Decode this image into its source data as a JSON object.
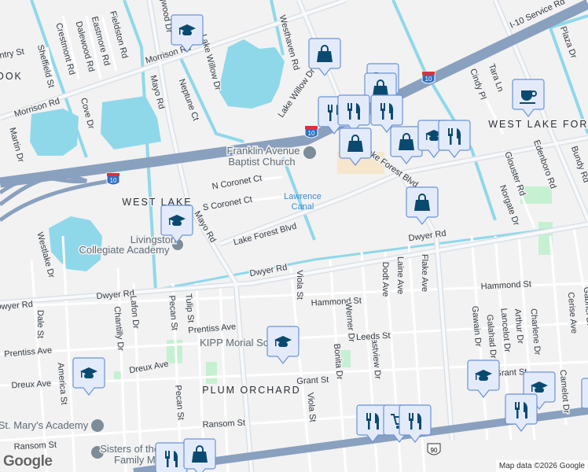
{
  "map": {
    "areas": [
      "WEST LAKE",
      "WEST LAKE FOREST",
      "PLUM ORCHARD",
      "OOK"
    ],
    "streets": [
      "Morrison Rd",
      "Morrison Rd",
      "Mayo Rd",
      "Mayo Rd",
      "Neptune Ct",
      "Lake Willow Dr",
      "Westhaven Rd",
      "Lake Willow Dr",
      "Crestmont Rd",
      "Dalewood Rd",
      "Eastmore Rd",
      "Fieldston Rd",
      "Sheffield St",
      "Cove Dr",
      "Martin Dr",
      "Dogwood Dr",
      "N Coronet Ct",
      "S Coronet Ct",
      "Lake Forest Blvd",
      "Dwyer Rd",
      "Dwyer Rd",
      "Dwyer Rd",
      "Dwyer Rd",
      "Westlake Dr",
      "I-10 Service Rd",
      "Cindy Pl",
      "Tara Ln",
      "Plaza Dr",
      "Edenboro Rd",
      "Glouster Rd",
      "Norgate Dr",
      "Bundy Rd",
      "Lake Forest Blvd",
      "Viola St",
      "Dodt Ave",
      "Laine Ave",
      "Flake Ave",
      "Hammond St",
      "Hammond St",
      "Werner Dr",
      "Eastview Dr",
      "Bonita Dr",
      "Leeds St",
      "Prentiss Ave",
      "Prentiss Ave",
      "Dreux Ave",
      "Dreux Ave",
      "Grant St",
      "Grant St",
      "Ransom St",
      "Ransom St",
      "Dale St",
      "America St",
      "Chantilly Dr",
      "Lafon Dr",
      "Pecan St",
      "Tulip St",
      "Pecan St",
      "Viola St",
      "Gawain Dr",
      "Galahad Dr",
      "Lancelot Dr",
      "Arthur Dr",
      "Charlene Dr",
      "Cerise Ave",
      "Gabriel Dr",
      "Camelot Dr",
      "Entry St"
    ],
    "places": [
      "Franklin Avenue",
      "Baptist Church",
      "Livingston",
      "Collegiate Academy",
      "KIPP Morial School",
      "St. Mary's Academy",
      "Sisters of the Holy",
      "Family Mo"
    ],
    "water": [
      "Lawrence",
      "Canal"
    ],
    "shields": {
      "i10": "10",
      "us90": "90"
    },
    "markers": [
      "school",
      "shopping",
      "grocery",
      "shopping",
      "restaurant",
      "restaurant",
      "restaurant",
      "shopping",
      "shopping",
      "school",
      "restaurant",
      "coffee",
      "school",
      "shopping",
      "school",
      "school",
      "school",
      "school",
      "restaurant",
      "shopping",
      "restaurant",
      "grocery",
      "restaurant",
      "restaurant",
      "shopping"
    ],
    "attribution": "Map data ©2026 Google",
    "logo": "Google",
    "colors": {
      "background": "#f2f2f2",
      "water": "#8fd8ea",
      "highway": "#8aa0bf",
      "road": "#ffffff",
      "park": "#c6f0d2",
      "marker_fill": "#e3ebfb",
      "marker_stroke": "#6a92d6",
      "icon": "#0b4a6f"
    }
  }
}
